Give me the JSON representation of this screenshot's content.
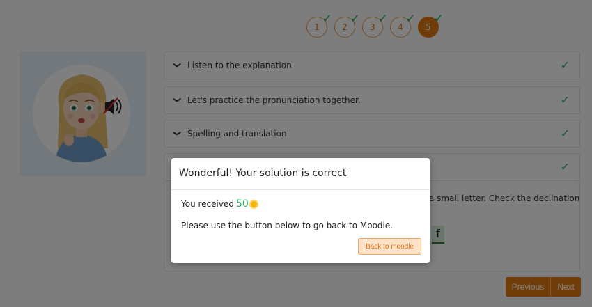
{
  "steps": [
    {
      "label": "1",
      "done": true
    },
    {
      "label": "2",
      "done": true
    },
    {
      "label": "3",
      "done": true
    },
    {
      "label": "4",
      "done": true
    },
    {
      "label": "5",
      "done": true
    }
  ],
  "sections": [
    {
      "label": "Listen to the explanation"
    },
    {
      "label": "Let's practice the pronunciation together."
    },
    {
      "label": "Spelling and translation"
    }
  ],
  "open_section": {
    "partial_text": "a small letter. Check the declination",
    "letter": "f"
  },
  "nav": {
    "previous_label": "Previous",
    "next_label": "Next"
  },
  "modal": {
    "title": "Wonderful! Your solution is correct",
    "received_label": "You received",
    "points": "50",
    "instruction": "Please use the button below to go back to Moodle.",
    "button_label": "Back to moodle"
  },
  "colors": {
    "accent": "#e07a11",
    "success": "#27ae60"
  }
}
